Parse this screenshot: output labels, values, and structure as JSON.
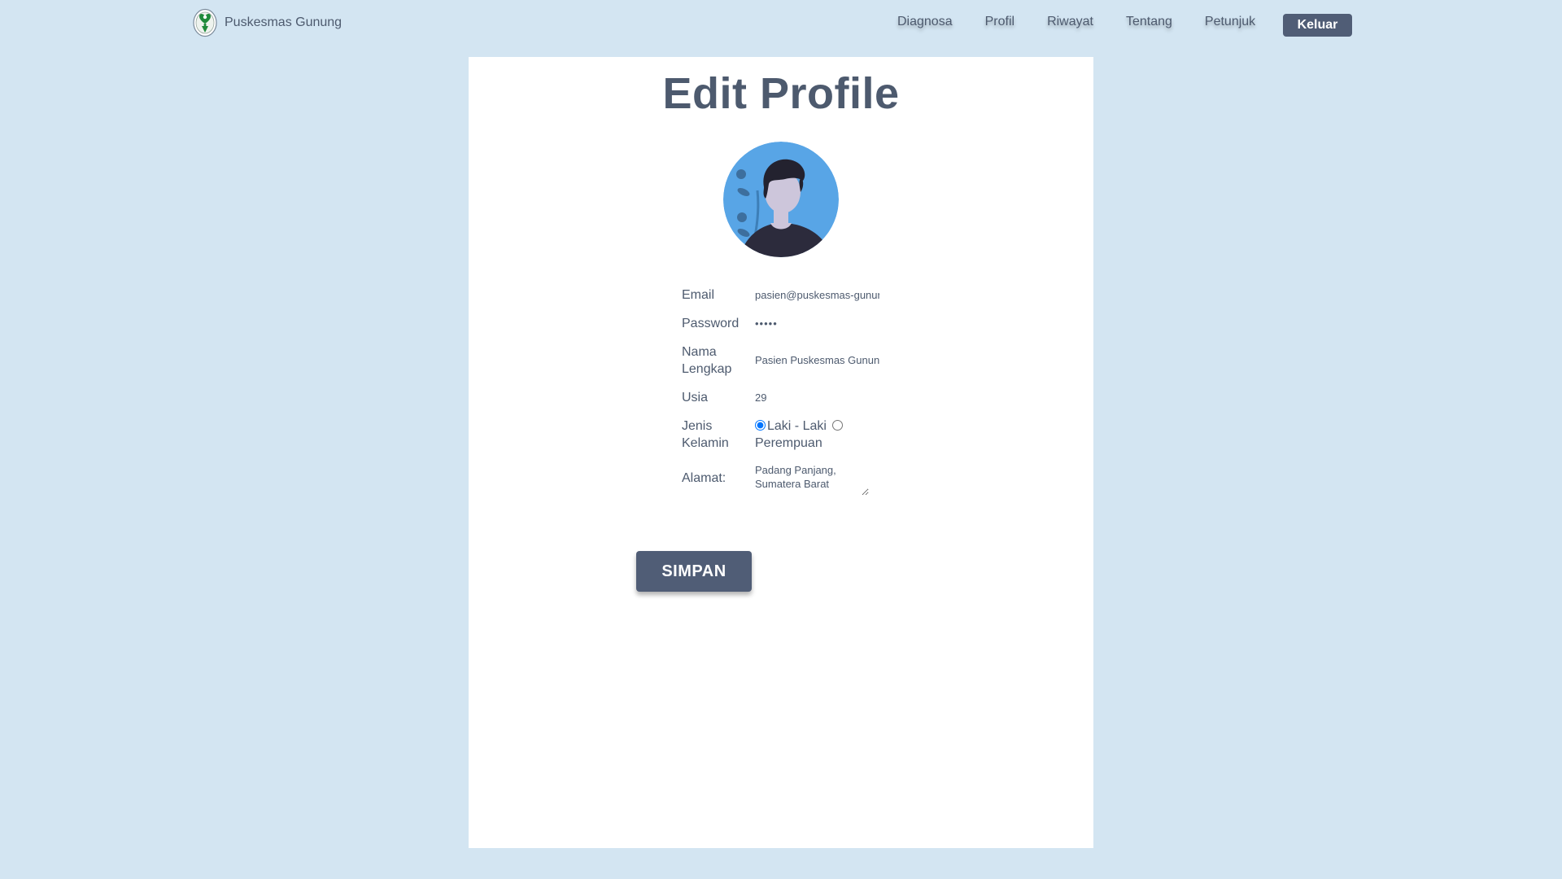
{
  "brand": {
    "name": "Puskesmas Gunung",
    "logo_icon": "health-logo-icon"
  },
  "nav": {
    "links": [
      "Diagnosa",
      "Profil",
      "Riwayat",
      "Tentang",
      "Petunjuk"
    ],
    "logout_label": "Keluar"
  },
  "page": {
    "title": "Edit Profile",
    "avatar_icon": "avatar-icon"
  },
  "form": {
    "email": {
      "label": "Email",
      "value": "pasien@puskesmas-gunung"
    },
    "password": {
      "label": "Password",
      "value": "•••••"
    },
    "full_name": {
      "label_line1": "Nama",
      "label_line2": "Lengkap",
      "value": "Pasien Puskesmas Gunung"
    },
    "age": {
      "label": "Usia",
      "value": "29"
    },
    "gender": {
      "label_line1": "Jenis",
      "label_line2": "Kelamin",
      "options": [
        "Laki - Laki",
        "Perempuan"
      ],
      "selected": "Laki - Laki"
    },
    "address": {
      "label": "Alamat:",
      "value": "Padang Panjang, Sumatera Barat"
    },
    "save_label": "SIMPAN"
  },
  "colors": {
    "background": "#d3e5f2",
    "accent": "#505d76",
    "text": "#4d5a6e",
    "card": "#ffffff"
  }
}
